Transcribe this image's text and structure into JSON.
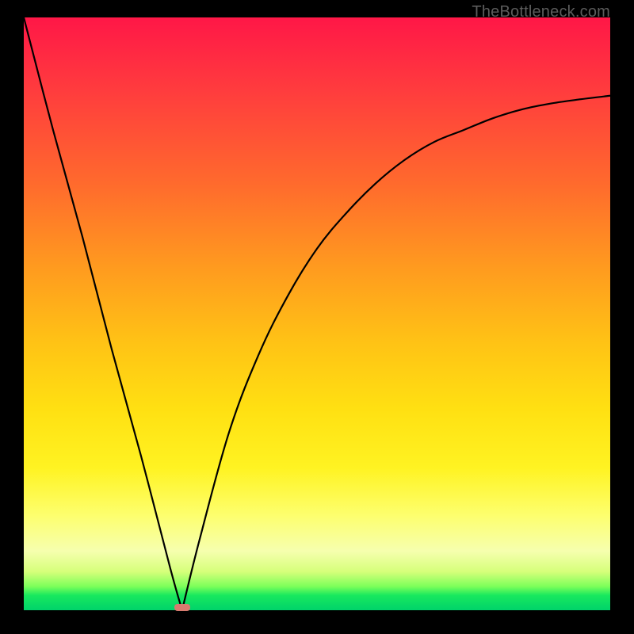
{
  "watermark": "TheBottleneck.com",
  "colors": {
    "frame": "#000000",
    "gradient_top": "#ff1747",
    "gradient_mid": "#ffe012",
    "gradient_bottom": "#00d36a",
    "curve": "#000000",
    "marker": "#d77b6f"
  },
  "chart_data": {
    "type": "line",
    "title": "",
    "xlabel": "",
    "ylabel": "",
    "xlim": [
      0,
      100
    ],
    "ylim": [
      0,
      100
    ],
    "categories_note": "Axes are unlabeled; values are read as percentages of plot width/height, with y measured from the bottom.",
    "series": [
      {
        "name": "left-branch",
        "x": [
          0,
          5,
          10,
          15,
          20,
          25,
          27
        ],
        "values": [
          100,
          81,
          63,
          44,
          26,
          7,
          0
        ]
      },
      {
        "name": "right-branch",
        "x": [
          27,
          30,
          35,
          40,
          45,
          50,
          55,
          60,
          65,
          70,
          75,
          80,
          85,
          90,
          95,
          100
        ],
        "values": [
          0,
          12,
          30,
          43,
          53,
          61,
          67,
          72,
          76,
          79,
          81,
          83,
          84.5,
          85.5,
          86.2,
          86.8
        ]
      }
    ],
    "marker": {
      "x": 27,
      "y": 0.6,
      "label": ""
    }
  }
}
